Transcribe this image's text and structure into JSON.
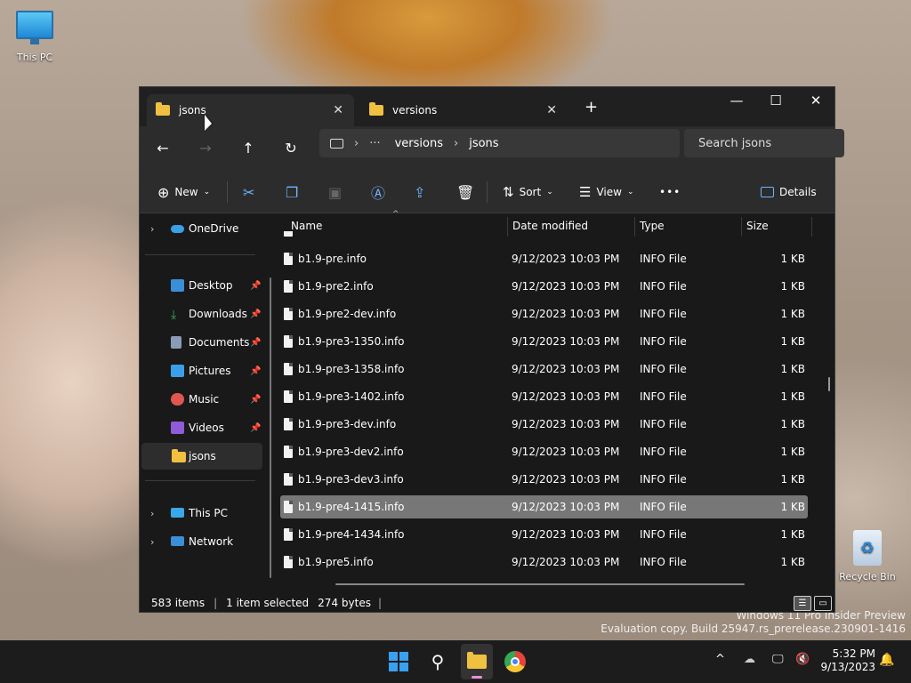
{
  "desktop": {
    "this_pc_label": "This PC",
    "recycle_bin_label": "Recycle Bin",
    "watermark_line1": "Windows 11 Pro Insider Preview",
    "watermark_line2": "Evaluation copy. Build 25947.rs_prerelease.230901-1416"
  },
  "window": {
    "tabs": [
      {
        "label": "jsons",
        "active": true
      },
      {
        "label": "versions",
        "active": false
      }
    ],
    "new_tab_label": "+",
    "minimize_label": "—",
    "maximize_label": "☐",
    "close_label": "✕"
  },
  "navbar": {
    "back_icon": "arrow-left-icon",
    "forward_icon": "arrow-right-icon",
    "up_icon": "arrow-up-icon",
    "refresh_icon": "refresh-icon",
    "breadcrumb": [
      "versions",
      "jsons"
    ],
    "search_placeholder": "Search jsons"
  },
  "commandbar": {
    "new_label": "New",
    "sort_label": "Sort",
    "view_label": "View",
    "details_label": "Details",
    "more_label": "•••"
  },
  "sidebar": {
    "onedrive": "OneDrive",
    "quick": [
      {
        "label": "Desktop",
        "color": "#3a8fd8"
      },
      {
        "label": "Downloads",
        "color": "#3aa865"
      },
      {
        "label": "Documents",
        "color": "#8a9bb5"
      },
      {
        "label": "Pictures",
        "color": "#3a9fe8"
      },
      {
        "label": "Music",
        "color": "#e0574f"
      },
      {
        "label": "Videos",
        "color": "#8e5cd9"
      },
      {
        "label": "jsons",
        "color": "#f0c040"
      }
    ],
    "this_pc": "This PC",
    "network": "Network"
  },
  "columns": {
    "name": "Name",
    "date": "Date modified",
    "type": "Type",
    "size": "Size"
  },
  "files": [
    {
      "name": "b1.9-pre.info",
      "date": "9/12/2023 10:03 PM",
      "type": "INFO File",
      "size": "1 KB"
    },
    {
      "name": "b1.9-pre2.info",
      "date": "9/12/2023 10:03 PM",
      "type": "INFO File",
      "size": "1 KB"
    },
    {
      "name": "b1.9-pre2-dev.info",
      "date": "9/12/2023 10:03 PM",
      "type": "INFO File",
      "size": "1 KB"
    },
    {
      "name": "b1.9-pre3-1350.info",
      "date": "9/12/2023 10:03 PM",
      "type": "INFO File",
      "size": "1 KB"
    },
    {
      "name": "b1.9-pre3-1358.info",
      "date": "9/12/2023 10:03 PM",
      "type": "INFO File",
      "size": "1 KB"
    },
    {
      "name": "b1.9-pre3-1402.info",
      "date": "9/12/2023 10:03 PM",
      "type": "INFO File",
      "size": "1 KB"
    },
    {
      "name": "b1.9-pre3-dev.info",
      "date": "9/12/2023 10:03 PM",
      "type": "INFO File",
      "size": "1 KB"
    },
    {
      "name": "b1.9-pre3-dev2.info",
      "date": "9/12/2023 10:03 PM",
      "type": "INFO File",
      "size": "1 KB"
    },
    {
      "name": "b1.9-pre3-dev3.info",
      "date": "9/12/2023 10:03 PM",
      "type": "INFO File",
      "size": "1 KB"
    },
    {
      "name": "b1.9-pre4-1415.info",
      "date": "9/12/2023 10:03 PM",
      "type": "INFO File",
      "size": "1 KB",
      "selected": true
    },
    {
      "name": "b1.9-pre4-1434.info",
      "date": "9/12/2023 10:03 PM",
      "type": "INFO File",
      "size": "1 KB"
    },
    {
      "name": "b1.9-pre5.info",
      "date": "9/12/2023 10:03 PM",
      "type": "INFO File",
      "size": "1 KB"
    }
  ],
  "status": {
    "items": "583 items",
    "selected": "1 item selected",
    "bytes": "274 bytes"
  },
  "taskbar": {
    "time": "5:32 PM",
    "date": "9/13/2023"
  }
}
